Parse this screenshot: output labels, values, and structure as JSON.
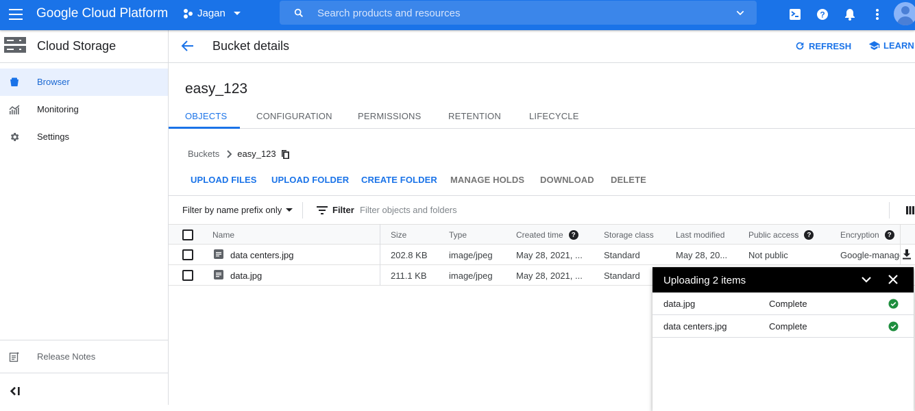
{
  "topbar": {
    "brand": "Google Cloud Platform",
    "project": "Jagan",
    "search_placeholder": "Search products and resources",
    "colors": {
      "bar": "#1a73e8",
      "search": "#3b86ea"
    }
  },
  "sidebar": {
    "title": "Cloud Storage",
    "items": [
      {
        "label": "Browser",
        "icon": "bucket-icon",
        "active": true
      },
      {
        "label": "Monitoring",
        "icon": "monitoring-icon",
        "active": false
      },
      {
        "label": "Settings",
        "icon": "gear-icon",
        "active": false
      }
    ],
    "release_notes": "Release Notes",
    "collapse_label": "<|"
  },
  "header": {
    "title": "Bucket details",
    "refresh_label": "REFRESH",
    "learn_label": "LEARN"
  },
  "bucket": {
    "name": "easy_123",
    "tabs": [
      {
        "label": "OBJECTS",
        "active": true
      },
      {
        "label": "CONFIGURATION",
        "active": false
      },
      {
        "label": "PERMISSIONS",
        "active": false
      },
      {
        "label": "RETENTION",
        "active": false
      },
      {
        "label": "LIFECYCLE",
        "active": false
      }
    ],
    "breadcrumb": {
      "root": "Buckets",
      "current": "easy_123"
    },
    "actions": [
      {
        "label": "UPLOAD FILES",
        "enabled": true
      },
      {
        "label": "UPLOAD FOLDER",
        "enabled": true
      },
      {
        "label": "CREATE FOLDER",
        "enabled": true
      },
      {
        "label": "MANAGE HOLDS",
        "enabled": false
      },
      {
        "label": "DOWNLOAD",
        "enabled": false
      },
      {
        "label": "DELETE",
        "enabled": false
      }
    ]
  },
  "filter": {
    "mode": "Filter by name prefix only",
    "label": "Filter",
    "placeholder": "Filter objects and folders"
  },
  "table": {
    "columns": [
      "Name",
      "Size",
      "Type",
      "Created time",
      "Storage class",
      "Last modified",
      "Public access",
      "Encryption"
    ],
    "rows": [
      {
        "name": "data centers.jpg",
        "size": "202.8 KB",
        "type": "image/jpeg",
        "created": "May 28, 2021, ...",
        "storage_class": "Standard",
        "modified": "May 28, 20...",
        "public_access": "Not public",
        "encryption": "Google-managed"
      },
      {
        "name": "data.jpg",
        "size": "211.1 KB",
        "type": "image/jpeg",
        "created": "May 28, 2021, ...",
        "storage_class": "Standard",
        "modified": "",
        "public_access": "",
        "encryption": ""
      }
    ]
  },
  "upload_panel": {
    "title": "Uploading 2 items",
    "items": [
      {
        "name": "data.jpg",
        "status": "Complete"
      },
      {
        "name": "data centers.jpg",
        "status": "Complete"
      }
    ],
    "status_color": "#1e8e3e"
  }
}
